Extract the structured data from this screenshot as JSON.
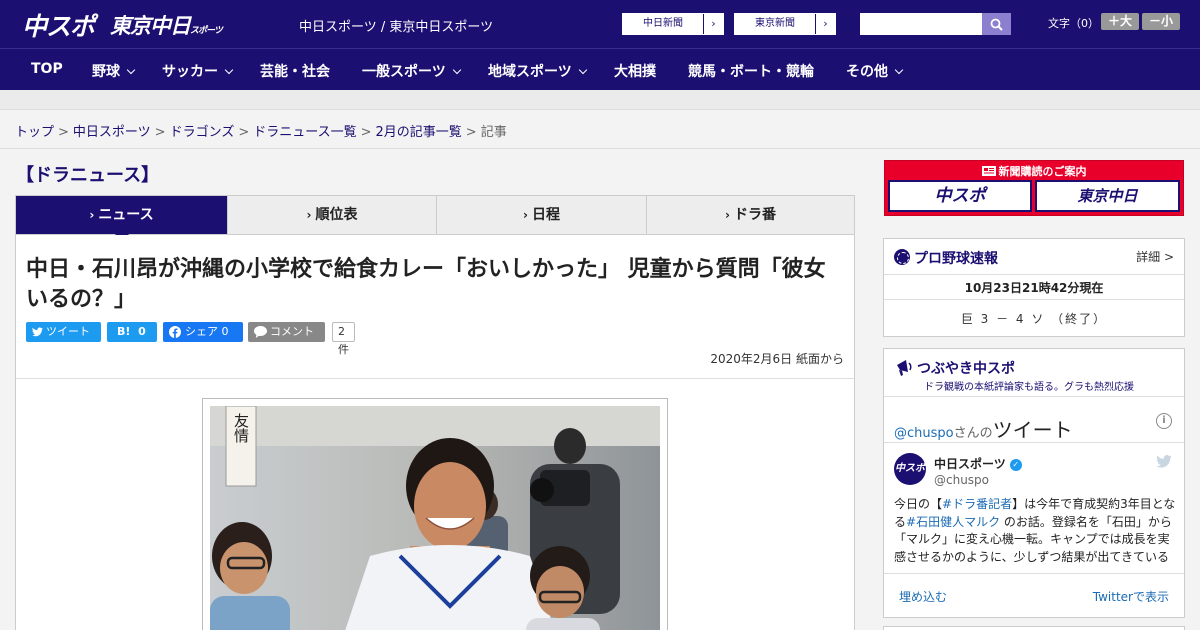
{
  "header": {
    "logo_chuspo": "中スポ",
    "logo_tokyo": "東京中日",
    "logo_tokyo_small": "スポーツ",
    "site_name": "中日スポーツ / 東京中日スポーツ",
    "link_chunichi": "中日新聞",
    "link_tokyo": "東京新聞",
    "link_arrow": "›",
    "search_placeholder": "",
    "font_size_label": "文字（0）",
    "font_plus": "＋大",
    "font_minus": "－小"
  },
  "nav": {
    "items": [
      "TOP",
      "野球",
      "サッカー",
      "芸能・社会",
      "一般スポーツ",
      "地域スポーツ",
      "大相撲",
      "競馬・ボート・競輪",
      "その他"
    ]
  },
  "breadcrumb": {
    "items": [
      "トップ",
      "中日スポーツ",
      "ドラゴンズ",
      "ドラニュース一覧",
      "2月の記事一覧"
    ],
    "current": "記事",
    "separator": ">"
  },
  "section_title": "【ドラニュース】",
  "tabs": [
    {
      "label": "ニュース",
      "active": true
    },
    {
      "label": "順位表",
      "active": false
    },
    {
      "label": "日程",
      "active": false
    },
    {
      "label": "ドラ番",
      "active": false
    }
  ],
  "tab_marker": "›",
  "article": {
    "headline": "中日・石川昂が沖縄の小学校で給食カレー「おいしかった」 児童から質問「彼女いるの？」",
    "share": {
      "tweet": "ツイート",
      "hatena": "B!",
      "hatena_count": "0",
      "facebook": "シェア",
      "facebook_count": "0",
      "comment": "コメント",
      "comment_count": "2件"
    },
    "date": "2020年2月6日 紙面から",
    "photo_sign": "友情"
  },
  "sidebar": {
    "ad": {
      "title": "新聞購読のご案内",
      "logo_a": "中スポ",
      "logo_b": "東京中日"
    },
    "baseball": {
      "title": "プロ野球速報",
      "more": "詳細 >",
      "time": "10月23日21時42分現在",
      "score": "巨 3 － 4 ソ （終了）"
    },
    "tweets": {
      "title": "つぶやき中スポ",
      "subtitle": "ドラ観戦の本紙評論家も語る。グラも熱烈応援",
      "handle": "@chuspo",
      "handle_suffix": "さんの",
      "heading": "ツイート",
      "info": "i",
      "account_name": "中日スポーツ",
      "account_handle": "@chuspo",
      "avatar_text": "中スポ",
      "verified_mark": "✓",
      "text_1": "今日の【",
      "tag_1": "#ドラ番記者",
      "text_2": "】は今年で育成契約3年目となる",
      "tag_2": "#石田健人マルク",
      "text_3": " のお話。登録名を「石田」から「マルク」に変え心機一転。キャンプでは成長を実感させるかのように、少しずつ結果が出てきている",
      "embed": "埋め込む",
      "view": "Twitterで表示"
    }
  },
  "colors": {
    "brand": "#1b0f72",
    "ad_red": "#e8002b",
    "twitter_blue": "#1d9bf0",
    "facebook_blue": "#1877f2"
  }
}
